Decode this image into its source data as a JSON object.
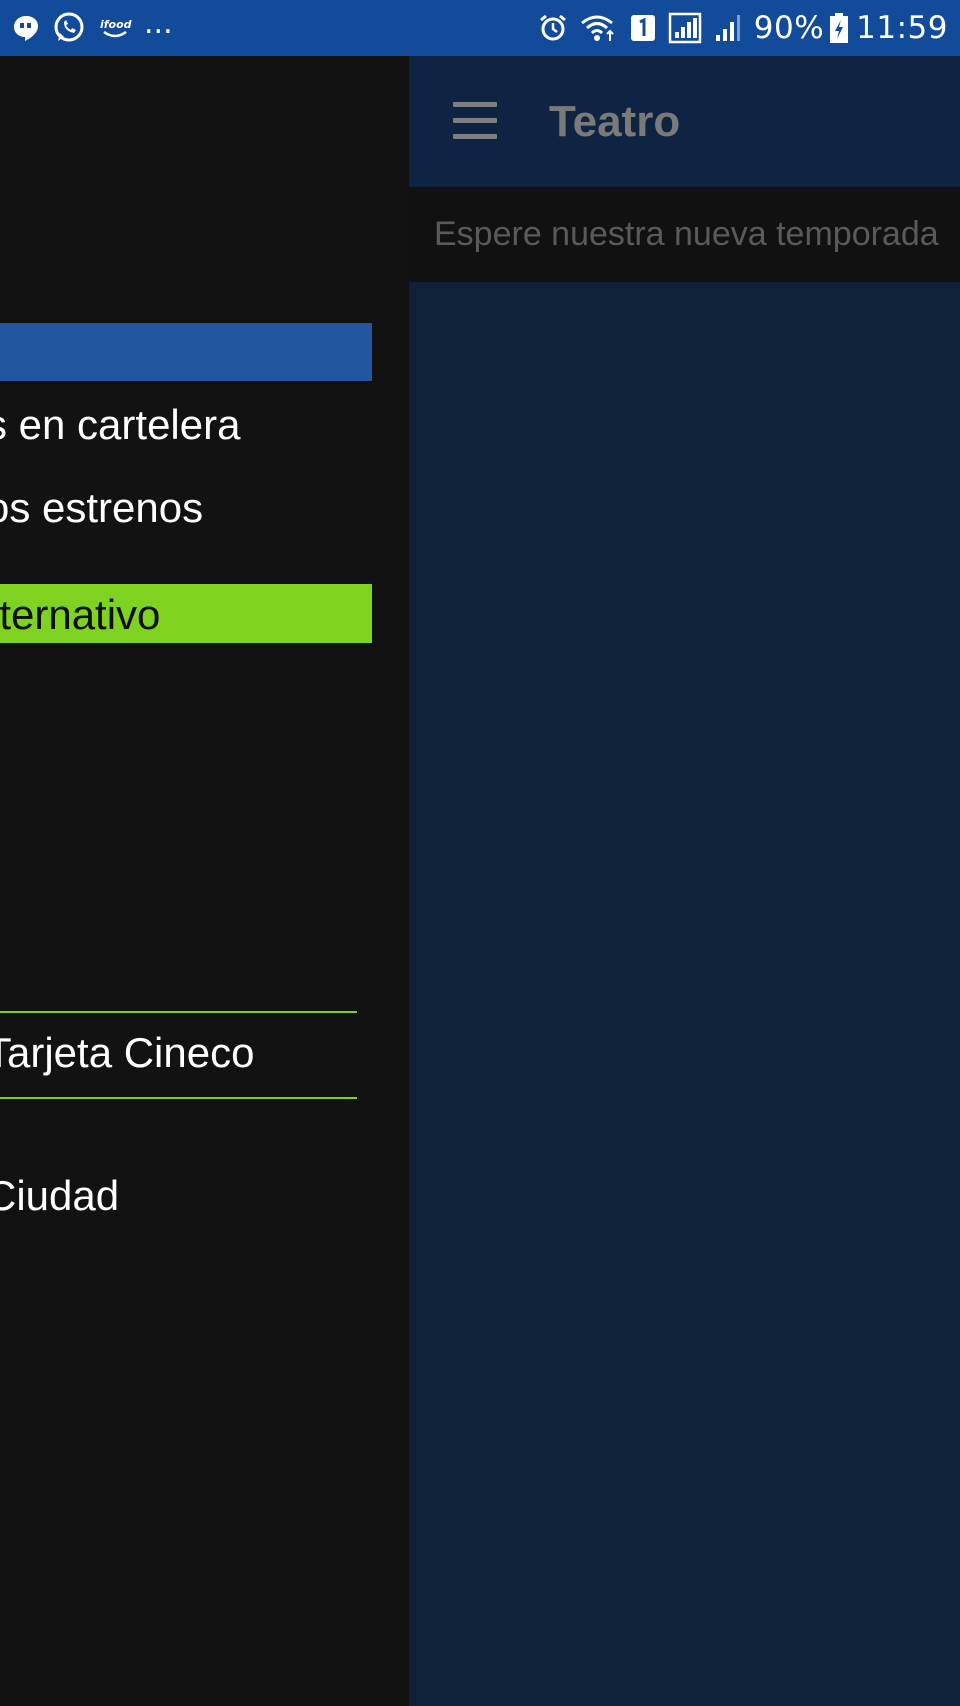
{
  "status_bar": {
    "more": "...",
    "battery": "90%",
    "time": "11:59"
  },
  "drawer": {
    "items": [
      {
        "label": "s en cartelera"
      },
      {
        "label": "os estrenos"
      },
      {
        "label": "lternativo"
      },
      {
        "label": "Tarjeta Cineco"
      },
      {
        "label": "Ciudad"
      }
    ]
  },
  "appbar": {
    "title": "Teatro"
  },
  "notice": {
    "text": "Espere nuestra nueva temporada"
  },
  "colors": {
    "status_bar": "#134b9b",
    "drawer_bg": "#121212",
    "drawer_band": "#2456a0",
    "accent_green": "#7ed321",
    "main_bg": "#0f2039",
    "appbar_bg": "#0f2443"
  }
}
